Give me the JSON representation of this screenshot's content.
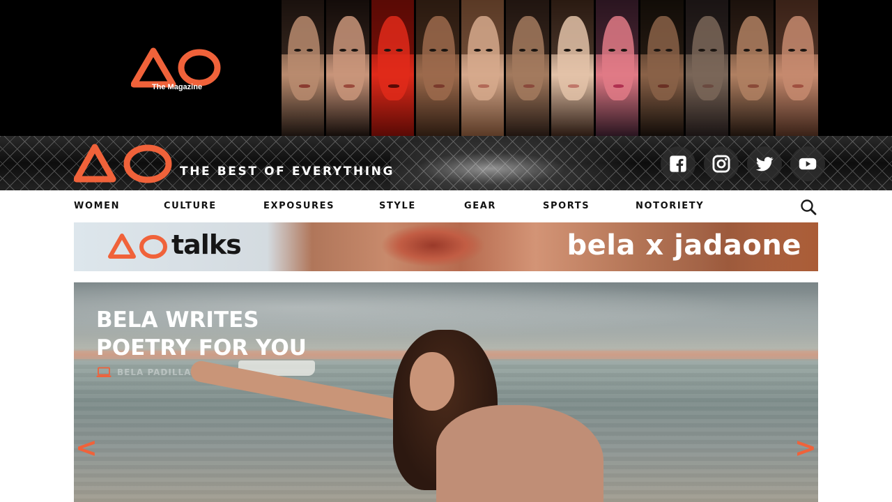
{
  "top_banner": {
    "logo_caption": "The Magazine",
    "brand_color": "#f0623a",
    "faces": [
      {
        "skin": "#b98b6e",
        "hair": "#1a120e",
        "lip": "#8a3b30"
      },
      {
        "skin": "#c9957a",
        "hair": "#140d0a",
        "lip": "#9a4a3c"
      },
      {
        "skin": "#e02a1a",
        "hair": "#5a0a05",
        "lip": "#5a0a05"
      },
      {
        "skin": "#9c6a4c",
        "hair": "#2a1a10",
        "lip": "#7a3a2c"
      },
      {
        "skin": "#d6a98c",
        "hair": "#5a3a26",
        "lip": "#b26a58"
      },
      {
        "skin": "#a37a5e",
        "hair": "#201510",
        "lip": "#8a4a3c"
      },
      {
        "skin": "#e3c2a8",
        "hair": "#2a1a12",
        "lip": "#c0786a"
      },
      {
        "skin": "#e07a86",
        "hair": "#2a1520",
        "lip": "#b03050"
      },
      {
        "skin": "#8a6248",
        "hair": "#120c08",
        "lip": "#6a3024"
      },
      {
        "skin": "#7a6658",
        "hair": "#1a1414",
        "lip": "#6a4a40"
      },
      {
        "skin": "#b08062",
        "hair": "#1c120c",
        "lip": "#8a4a38"
      },
      {
        "skin": "#c68a6e",
        "hair": "#3a2218",
        "lip": "#a05040"
      }
    ]
  },
  "header": {
    "tagline": "THE BEST OF EVERYTHING",
    "socials": [
      {
        "icon": "facebook-icon"
      },
      {
        "icon": "instagram-icon"
      },
      {
        "icon": "twitter-icon"
      },
      {
        "icon": "youtube-icon"
      }
    ]
  },
  "nav": {
    "items": [
      "WOMEN",
      "CULTURE",
      "EXPOSURES",
      "STYLE",
      "GEAR",
      "SPORTS",
      "NOTORIETY"
    ],
    "search_icon": "search-icon"
  },
  "talks_banner": {
    "word": "talks",
    "headline": "bela x jadaone"
  },
  "hero": {
    "title_line1": "BELA WRITES",
    "title_line2": "POETRY FOR YOU",
    "byline": "BELA PADILLA",
    "byline_icon": "laptop-icon",
    "prev_label": "<",
    "next_label": ">"
  }
}
